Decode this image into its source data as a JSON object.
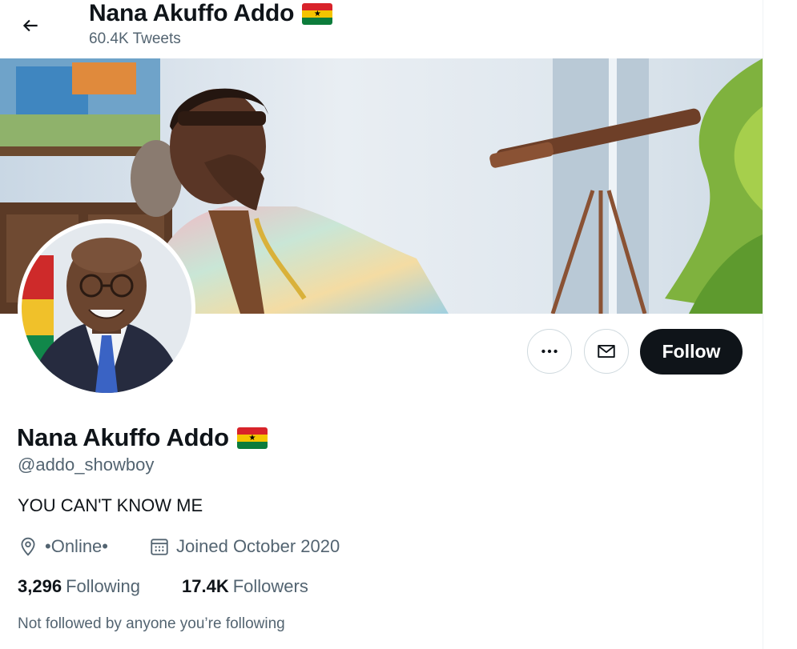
{
  "header": {
    "back_icon": "arrow-left-icon",
    "name": "Nana Akuffo Addo",
    "flag_icon": "ghana-flag-icon",
    "tweet_count": "60.4K Tweets"
  },
  "banner": {
    "description": "cover photo"
  },
  "avatar": {
    "description": "profile photo"
  },
  "actions": {
    "more_icon": "more-horizontal-icon",
    "message_icon": "envelope-icon",
    "follow_label": "Follow"
  },
  "profile": {
    "name": "Nana Akuffo Addo",
    "handle": "@addo_showboy",
    "bio": "YOU CAN'T KNOW ME",
    "location_icon": "location-pin-icon",
    "location": "•Online•",
    "calendar_icon": "calendar-icon",
    "joined": "Joined October 2020"
  },
  "stats": {
    "following_count": "3,296",
    "following_label": "Following",
    "followers_count": "17.4K",
    "followers_label": "Followers"
  },
  "followed_by_text": "Not followed by anyone you’re following",
  "colors": {
    "text_primary": "#0f1419",
    "text_secondary": "#536471",
    "border": "#cfd9de",
    "follow_bg": "#0f1419"
  }
}
